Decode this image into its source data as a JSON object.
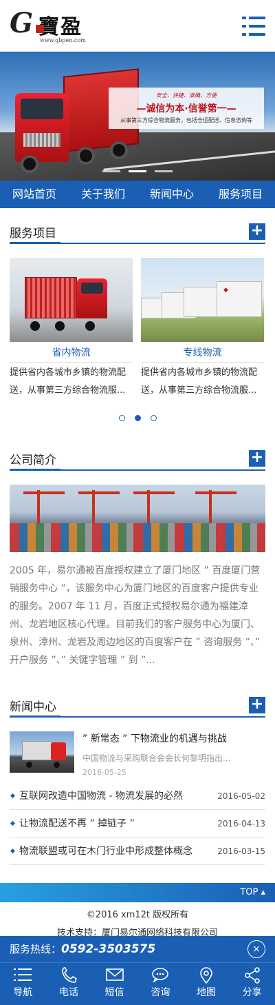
{
  "logo": {
    "letter": "G",
    "cn": "寶盈",
    "url": "www.gbpen.com"
  },
  "banner": {
    "tags": "安全、快捷、准确、方便",
    "slogan": "—诚信为本·信誉第一—",
    "sub": "从事第三方综合物流服务，包括仓运配送、信息咨询等"
  },
  "nav": [
    "网站首页",
    "关于我们",
    "新闻中心",
    "服务项目"
  ],
  "services": {
    "title": "服务项目",
    "plus": "+",
    "items": [
      {
        "name": "省内物流",
        "desc": "提供省内各城市乡镇的物流配送，从事第三方综合物流服..."
      },
      {
        "name": "专线物流",
        "desc": "提供省内各城市乡镇的物流配送，从事第三方综合物流服..."
      }
    ]
  },
  "about": {
    "title": "公司简介",
    "plus": "+",
    "text": "2005 年，易尔通被百度授权建立了厦门地区 ” 百度厦门营销服务中心 ”，该服务中心为厦门地区的百度客户提供专业的服务。2007 年 11 月，百度正式授权易尔通为福建漳州、龙岩地区核心代理。目前我们的客户服务中心为厦门、泉州、漳州、龙岩及周边地区的百度客户在 ” 咨询服务 ”、” 开户服务 ”、” 关键字管理 ” 到 ”..."
  },
  "news": {
    "title": "新闻中心",
    "plus": "+",
    "top": {
      "title": "” 新常态 ” 下物流业的机遇与挑战",
      "desc": "中国物流与采购联合会会长何黎明指出...",
      "date": "2016-05-25"
    },
    "items": [
      {
        "title": "互联网改造中国物流 - 物流发展的必然",
        "date": "2016-05-02"
      },
      {
        "title": "让物流配送不再 ” 掉链子 ”",
        "date": "2016-04-13"
      },
      {
        "title": "物流联盟或可在木门行业中形成整体概念",
        "date": "2016-03-15"
      }
    ]
  },
  "footer": {
    "top": "TOP ▴",
    "copyright": "©2016 xm12t 版权所有",
    "support": "技术支持：厦门易尔通网络科技有限公司",
    "hotline_label": "服务热线：",
    "hotline_number": "0592-3503575",
    "close": "×"
  },
  "bottom_nav": [
    "导航",
    "电话",
    "短信",
    "咨询",
    "地图",
    "分享"
  ],
  "colors": {
    "brand": "#1a5fb4",
    "accent_red": "#c1121f"
  }
}
